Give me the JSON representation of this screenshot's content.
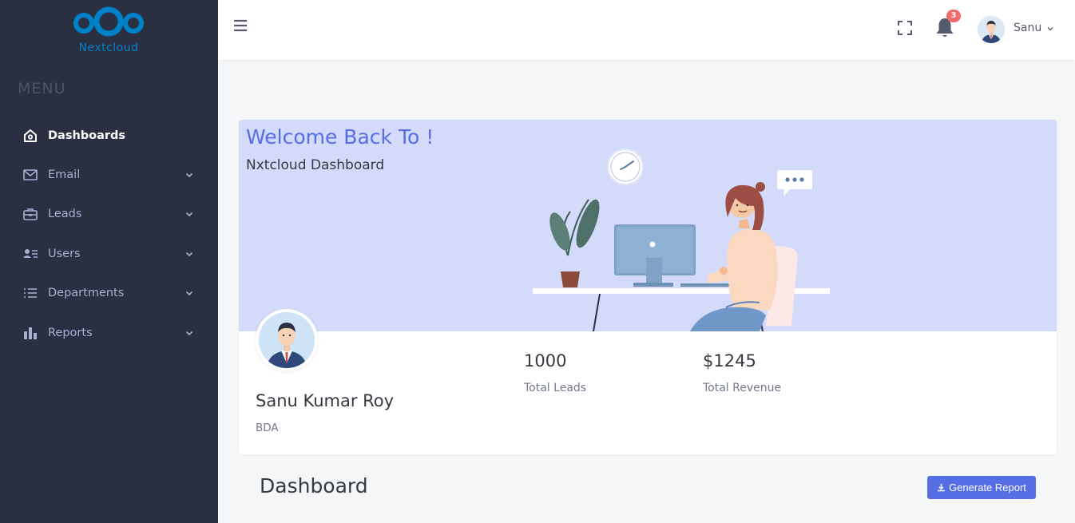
{
  "sidebar": {
    "logo_text": "Nextcloud",
    "menu_title": "MENU",
    "items": [
      {
        "label": "Dashboards",
        "icon": "home-icon"
      },
      {
        "label": "Email",
        "icon": "envelope-icon"
      },
      {
        "label": "Leads",
        "icon": "briefcase-icon"
      },
      {
        "label": "Users",
        "icon": "users-icon"
      },
      {
        "label": "Departments",
        "icon": "list-icon"
      },
      {
        "label": "Reports",
        "icon": "bar-chart-icon"
      }
    ]
  },
  "topbar": {
    "notification_count": "3",
    "user_name": "Sanu"
  },
  "welcome_card": {
    "title": "Welcome Back To !",
    "subtitle": "Nxtcloud Dashboard",
    "profile_name": "Sanu Kumar Roy",
    "profile_role": "BDA",
    "stats": [
      {
        "value": "1000",
        "label": "Total Leads"
      },
      {
        "value": "$1245",
        "label": "Total Revenue"
      }
    ]
  },
  "page": {
    "heading": "Dashboard",
    "generate_report_label": "Generate Report"
  },
  "colors": {
    "sidebar_bg": "#2a3042",
    "accent": "#556ee6",
    "banner_bg": "#d4daf9",
    "badge": "#f46a6a",
    "logo": "#0082c9"
  }
}
